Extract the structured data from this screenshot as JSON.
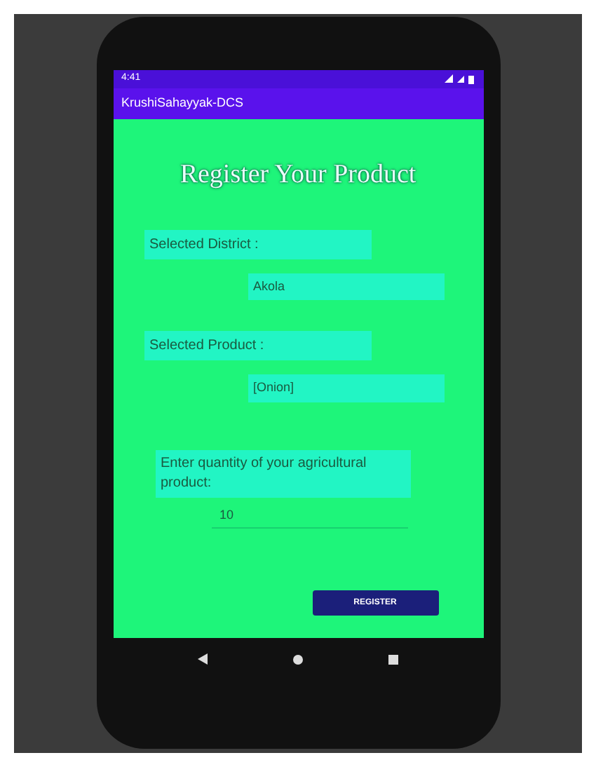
{
  "status_bar": {
    "time": "4:41"
  },
  "app_bar": {
    "title": "KrushiSahayyak-DCS"
  },
  "heading": "Register Your Product",
  "district": {
    "label": "Selected District :",
    "value": "Akola"
  },
  "product": {
    "label": "Selected Product :",
    "value": "[Onion]"
  },
  "quantity": {
    "label": "Enter quantity of your agricultural product:",
    "value": "10"
  },
  "button": "REGISTER"
}
